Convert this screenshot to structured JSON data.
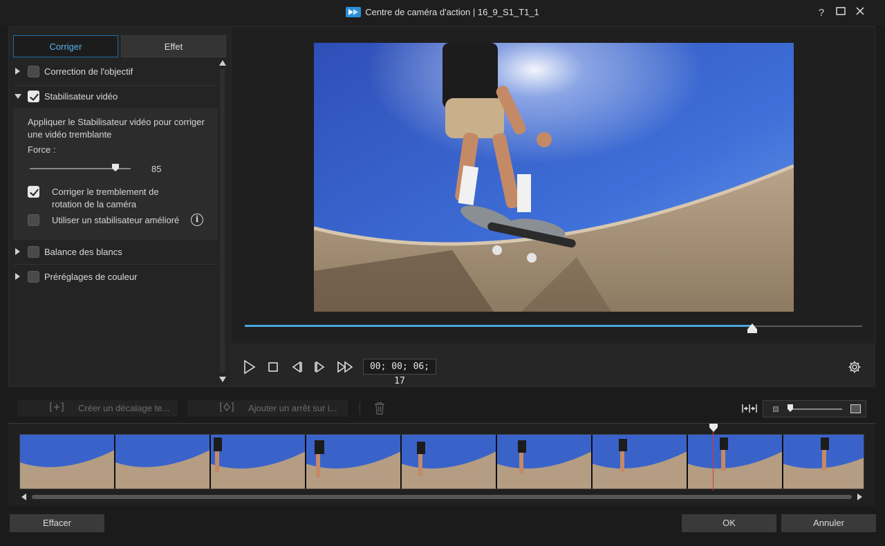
{
  "window": {
    "title": "Centre de caméra d'action  |  16_9_S1_T1_1",
    "help": "?",
    "close": "✕"
  },
  "tabs": {
    "correct": "Corriger",
    "effect": "Effet"
  },
  "sections": {
    "lens": "Correction de l'objectif",
    "stabilizer": "Stabilisateur vidéo",
    "white_balance": "Balance des blancs",
    "color_presets": "Préréglages de couleur"
  },
  "stabilizer": {
    "description": "Appliquer le Stabilisateur vidéo pour corriger une vidéo tremblante",
    "force_label": "Force :",
    "force_value": "85",
    "rotation_option": "Corriger le tremblement de rotation de la caméra",
    "enhanced_option": "Utiliser un stabilisateur amélioré"
  },
  "player": {
    "timecode": "00; 00; 06; 17",
    "progress": 0.822
  },
  "timeline": {
    "create_offset": "Créer un décalage te...",
    "add_freeze": "Ajouter un arrêt sur i..."
  },
  "buttons": {
    "clear": "Effacer",
    "ok": "OK",
    "cancel": "Annuler"
  },
  "colors": {
    "accent": "#4aa6dc",
    "playhead": "#d23a3a"
  }
}
